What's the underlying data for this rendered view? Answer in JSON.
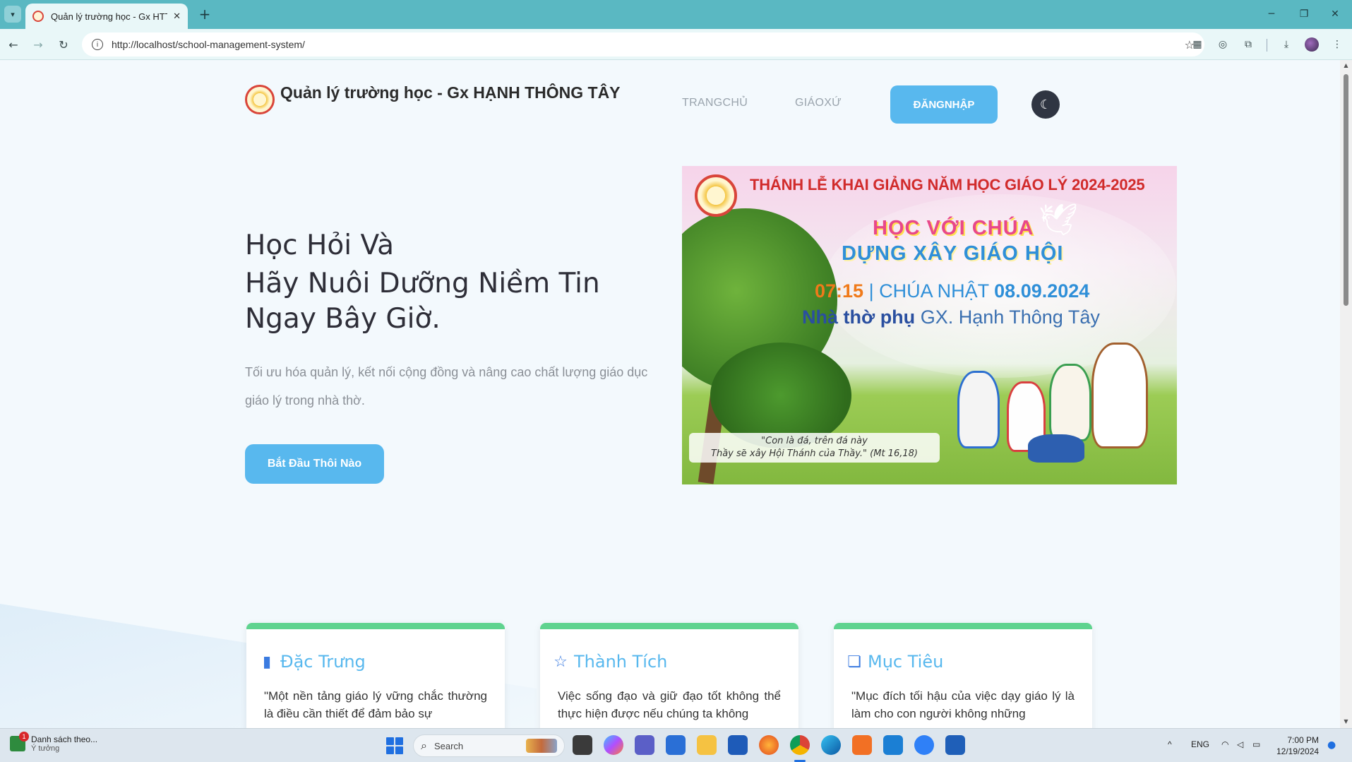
{
  "browser": {
    "tab_title": "Quản lý trường học - Gx HTT",
    "tab_close": "✕",
    "new_tab": "+",
    "url": "http://localhost/school-management-system/",
    "window_controls": {
      "minimize": "─",
      "restore": "❐",
      "close": "✕"
    }
  },
  "site": {
    "brand_title": "Quản lý trường học - Gx HẠNH THÔNG TÂY",
    "nav": {
      "home": "TRANGCHỦ",
      "parish": "GIÁOXỨ",
      "login": "ĐĂNGNHẬP"
    },
    "theme_icon": "moon-icon"
  },
  "hero": {
    "title_line1": "Học Hỏi Và",
    "title_line2": "Hãy Nuôi Dưỡng Niềm Tin Ngay Bây Giờ.",
    "description": "Tối ưu hóa quản lý, kết nối cộng đồng và nâng cao chất lượng giáo dục giáo lý trong nhà thờ.",
    "cta": "Bắt Đầu Thôi Nào"
  },
  "banner": {
    "heading": "THÁNH LỄ KHAI GIẢNG NĂM HỌC GIÁO LÝ 2024-2025",
    "line1": "HỌC VỚI CHÚA",
    "line2": "DỰNG XÂY GIÁO HỘI",
    "time": "07:15",
    "date_sep": "|",
    "date_label": "CHÚA NHẬT",
    "date_value": "08.09.2024",
    "place_bold": "Nhà thờ phụ",
    "place_rest": "GX. Hạnh Thông Tây",
    "quote_line1": "\"Con là đá, trên đá này",
    "quote_line2": "Thầy sẽ xây Hội Thánh của Thầy.\" (Mt 16,18)"
  },
  "cards": [
    {
      "icon": "book-icon",
      "title": "Đặc Trưng",
      "text": "\"Một nền tảng giáo lý vững chắc thường là điều cần thiết để đảm bảo sự"
    },
    {
      "icon": "star-icon",
      "title": "Thành Tích",
      "text": "Việc sống đạo và giữ đạo tốt không thể thực hiện được nếu chúng ta không"
    },
    {
      "icon": "bookmark-icon",
      "title": "Mục Tiêu",
      "text": "\"Mục đích tối hậu của việc dạy giáo lý là làm cho con người không những"
    }
  ],
  "taskbar": {
    "weather_badge": "1",
    "weather_title": "Danh sách theo...",
    "weather_sub": "Ý tưởng",
    "search_placeholder": "Search",
    "lang": "ENG",
    "time": "7:00 PM",
    "date": "12/19/2024",
    "tray_chevron": "^"
  },
  "colors": {
    "accent": "#58b8ee",
    "card_top": "#5fd38f",
    "browser_frame": "#5ab8c2",
    "banner_red": "#d12b2b"
  }
}
